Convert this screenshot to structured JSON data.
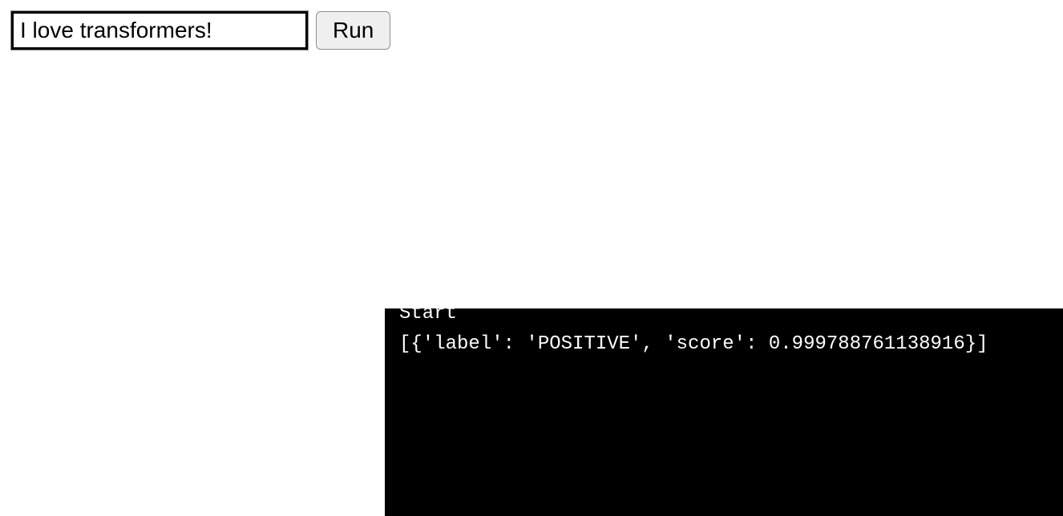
{
  "form": {
    "input_value": "I love transformers!",
    "run_label": "Run"
  },
  "console": {
    "line_start": "Start",
    "line_output": "[{'label': 'POSITIVE', 'score': 0.999788761138916}]"
  }
}
